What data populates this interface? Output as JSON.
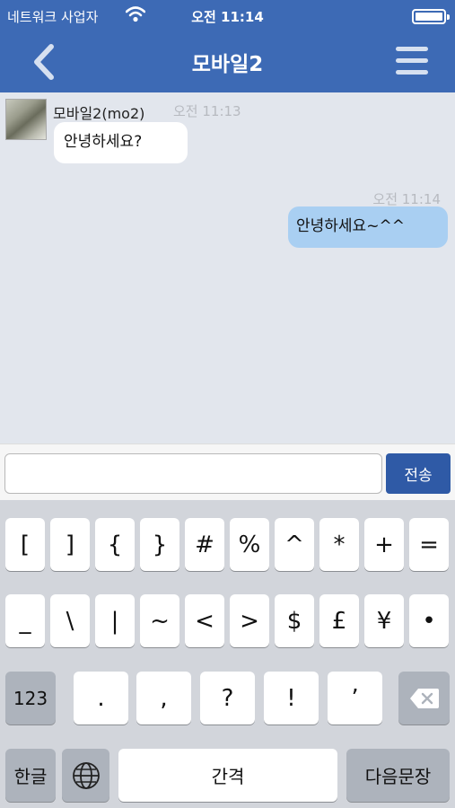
{
  "status_bar": {
    "carrier": "네트워크 사업자",
    "time": "오전 11:14"
  },
  "nav": {
    "title": "모바일2"
  },
  "messages": [
    {
      "direction": "in",
      "sender": "모바일2(mo2)",
      "time": "오전 11:13",
      "text": "안녕하세요?"
    },
    {
      "direction": "out",
      "time": "오전 11:14",
      "text": "안녕하세요~^^"
    }
  ],
  "input": {
    "value": "",
    "placeholder": ""
  },
  "send_label": "전송",
  "keyboard": {
    "row1": [
      "[",
      "]",
      "{",
      "}",
      "#",
      "%",
      "^",
      "*",
      "+",
      "="
    ],
    "row2": [
      "_",
      "\\",
      "|",
      "~",
      "<",
      ">",
      "$",
      "£",
      "¥",
      "•"
    ],
    "row3_left": "123",
    "row3": [
      ".",
      ",",
      "?",
      "!",
      "’"
    ],
    "lang_label": "한글",
    "space_label": "간격",
    "return_label": "다음문장"
  },
  "colors": {
    "header": "#3d6ab5",
    "chat_bg": "#e2e6ed",
    "outgoing_bubble": "#a9cff2",
    "send_button": "#2f5aa6"
  }
}
